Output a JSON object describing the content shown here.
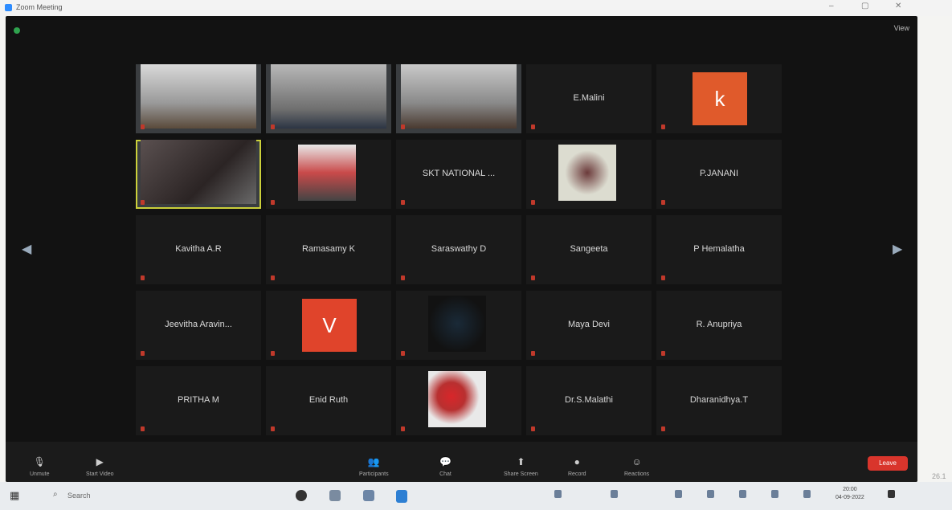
{
  "window": {
    "title": "Zoom Meeting",
    "controls": [
      "–",
      "▢",
      "✕"
    ]
  },
  "meeting": {
    "view_label": "View",
    "participants": [
      {
        "name": "",
        "type": "video",
        "label": "",
        "scene": "fan"
      },
      {
        "name": "",
        "type": "video",
        "label": "",
        "scene": "person"
      },
      {
        "name": "",
        "type": "video",
        "label": "",
        "scene": "person2"
      },
      {
        "name": "E.Malini",
        "type": "name"
      },
      {
        "name": "",
        "type": "avatar",
        "initial": "k",
        "color": "#e05a2b"
      },
      {
        "name": "",
        "type": "video",
        "label": "",
        "scene": "room",
        "active": true
      },
      {
        "name": "",
        "type": "picture",
        "label": "",
        "scene": "banner"
      },
      {
        "name": "SKT NATIONAL ...",
        "type": "name"
      },
      {
        "name": "",
        "type": "picture",
        "label": "",
        "scene": "flower"
      },
      {
        "name": "P.JANANI",
        "type": "name"
      },
      {
        "name": "Kavitha A.R",
        "type": "name"
      },
      {
        "name": "Ramasamy K",
        "type": "name"
      },
      {
        "name": "Saraswathy D",
        "type": "name"
      },
      {
        "name": "Sangeeta",
        "type": "name"
      },
      {
        "name": "P Hemalatha",
        "type": "name"
      },
      {
        "name": "Jeevitha Aravin...",
        "type": "name"
      },
      {
        "name": "",
        "type": "avatar",
        "initial": "V",
        "color": "#e0442b"
      },
      {
        "name": "",
        "type": "picture",
        "label": "",
        "scene": "dark"
      },
      {
        "name": "Maya Devi",
        "type": "name"
      },
      {
        "name": "R. Anupriya",
        "type": "name"
      },
      {
        "name": "PRITHA M",
        "type": "name"
      },
      {
        "name": "Enid Ruth",
        "type": "name"
      },
      {
        "name": "",
        "type": "picture",
        "label": "",
        "scene": "red"
      },
      {
        "name": "Dr.S.Malathi",
        "type": "name"
      },
      {
        "name": "Dharanidhya.T",
        "type": "name"
      }
    ],
    "toolbar": {
      "items": [
        {
          "label": "Unmute",
          "icon": "mic-icon",
          "glyph": "🎙"
        },
        {
          "label": "Start Video",
          "icon": "video-icon",
          "glyph": "▶"
        },
        {
          "label": "Participants",
          "icon": "participants-icon",
          "glyph": "👥"
        },
        {
          "label": "Chat",
          "icon": "chat-icon",
          "glyph": "💬"
        },
        {
          "label": "Share Screen",
          "icon": "share-icon",
          "glyph": "⬆"
        },
        {
          "label": "Record",
          "icon": "record-icon",
          "glyph": "●"
        },
        {
          "label": "Reactions",
          "icon": "reactions-icon",
          "glyph": "☺"
        }
      ],
      "leave_label": "Leave"
    }
  },
  "taskbar": {
    "search_label": "Search",
    "time": "20:00",
    "date": "04-09-2022"
  },
  "side_number": "26.1",
  "colors": {
    "accent": "#2d8cff",
    "leave": "#d9352c",
    "mic_off": "#c0392b",
    "active_speaker": "#cbd03a"
  }
}
